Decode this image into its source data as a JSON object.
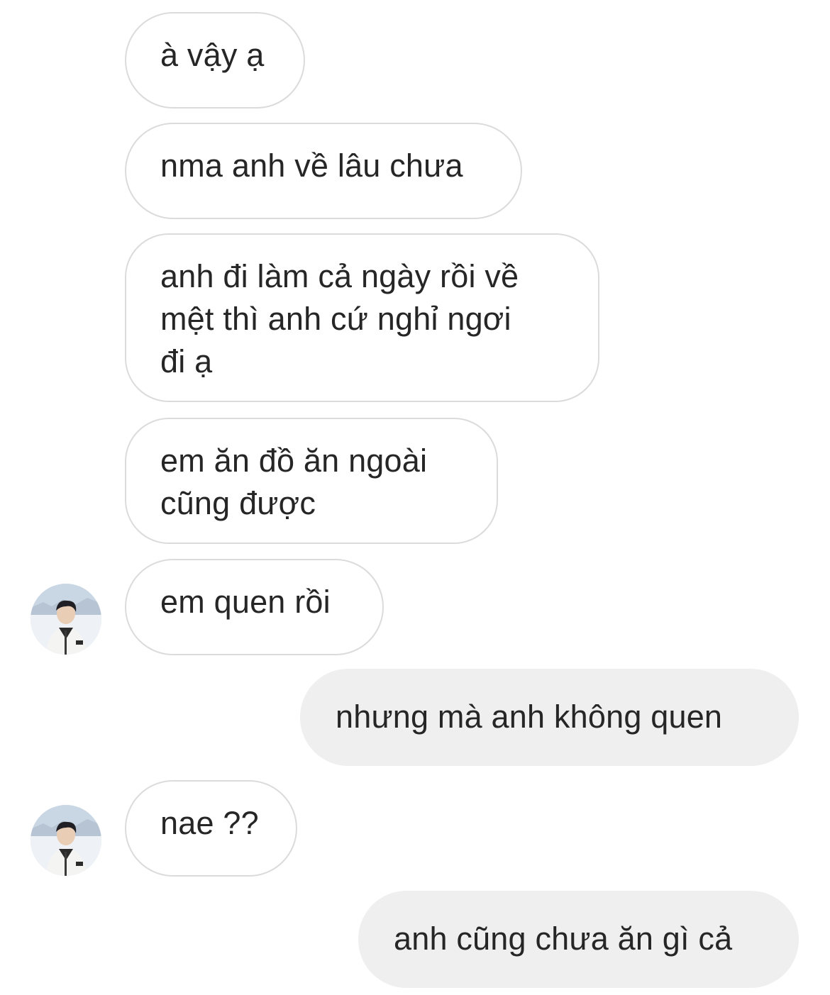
{
  "messages": [
    {
      "sender": "other",
      "text": "à vậy ạ"
    },
    {
      "sender": "other",
      "text": "nma anh về lâu chưa"
    },
    {
      "sender": "other",
      "text": "anh đi làm cả ngày rồi về\nmệt thì anh cứ nghỉ ngơi\nđi ạ"
    },
    {
      "sender": "other",
      "text": "em ăn đồ ăn ngoài\ncũng được"
    },
    {
      "sender": "other",
      "text": "em quen rồi"
    },
    {
      "sender": "self",
      "text": "nhưng mà anh không quen"
    },
    {
      "sender": "other",
      "text": "nae ??"
    },
    {
      "sender": "self",
      "text": "anh cũng chưa ăn gì cả"
    }
  ],
  "colors": {
    "incoming_bubble_bg": "#ffffff",
    "incoming_bubble_border": "#dbdbdb",
    "outgoing_bubble_bg": "#efefef",
    "text": "#262626"
  },
  "icons": {
    "avatar": "profile-photo-avatar"
  }
}
